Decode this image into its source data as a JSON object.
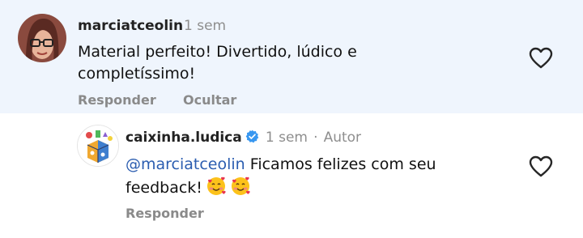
{
  "comment": {
    "username": "marciatceolin",
    "time": "1 sem",
    "text_line1": "Material perfeito! Divertido, lúdico e",
    "text_line2": "completíssimo!",
    "actions": {
      "reply": "Responder",
      "hide": "Ocultar"
    },
    "like_icon": "heart-outline-icon"
  },
  "reply": {
    "username": "caixinha.ludica",
    "verified_icon": "verified-badge-icon",
    "time": "1 sem",
    "separator": "·",
    "author_label": "Autor",
    "mention": "@marciatceolin",
    "text_line1_rest": " Ficamos felizes com seu",
    "text_line2": "feedback!",
    "emoji_icon": "smiling-face-with-hearts-emoji",
    "actions": {
      "reply": "Responder"
    },
    "like_icon": "heart-outline-icon"
  },
  "colors": {
    "highlight_bg": "#eff5fd",
    "mention": "#2b5db0",
    "verified": "#3897f0",
    "muted": "#8e8e8e"
  }
}
